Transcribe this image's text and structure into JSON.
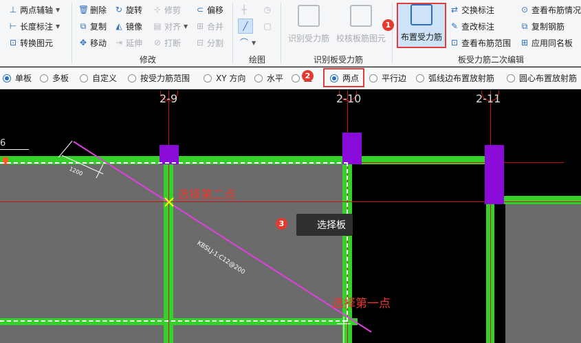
{
  "ribbon": {
    "axis": {
      "two_point_axis": "两点辅轴",
      "length_dim": "长度标注",
      "convert_element": "转换图元"
    },
    "modify": {
      "delete": "删除",
      "rotate": "旋转",
      "trim": "修剪",
      "offset": "偏移",
      "copy": "复制",
      "mirror": "镜像",
      "align": "对齐",
      "merge": "合并",
      "move": "移动",
      "extend": "延伸",
      "break": "打断",
      "split": "分割",
      "group_label": "修改"
    },
    "draw": {
      "group_label": "绘图"
    },
    "identify": {
      "identify_btn": "识别受力筋",
      "verify_btn": "校核板筋图元",
      "group_label": "识别板受力筋"
    },
    "rebar": {
      "place_btn": "布置受力筋",
      "swap_label": "交换标注",
      "modify_label": "查改标注",
      "view_range": "查看布筋范围",
      "view_status": "查看布筋情况",
      "copy_rebar": "复制钢筋",
      "apply_same": "应用同名板",
      "group_label": "板受力筋二次编辑"
    }
  },
  "options": {
    "single": "单板",
    "multi": "多板",
    "custom": "自定义",
    "by_range": "按受力筋范围",
    "xy": "XY 方向",
    "horizontal": "水平",
    "vertical": "直",
    "two_point": "两点",
    "parallel": "平行边",
    "arc_radial": "弧线边布置放射筋",
    "circle_radial": "圆心布置放射筋",
    "selected": "two_point"
  },
  "canvas": {
    "axes": [
      "2-9",
      "2-10",
      "2-11"
    ],
    "rebar_text": "KBSLJ-1:C12@200",
    "dim_text": "1200",
    "left_axis_fragment": "6",
    "pick_second": "选择第二点",
    "pick_first": "选择第一点",
    "tooltip": "选择板"
  },
  "badges": [
    "1",
    "2",
    "3"
  ],
  "colors": {
    "accent": "#2f6fbf",
    "highlight": "#e13b3b",
    "beam": "#35d02a",
    "column": "#8a0bd8",
    "rebar": "#e040e0",
    "slab": "#6b6b6b"
  }
}
